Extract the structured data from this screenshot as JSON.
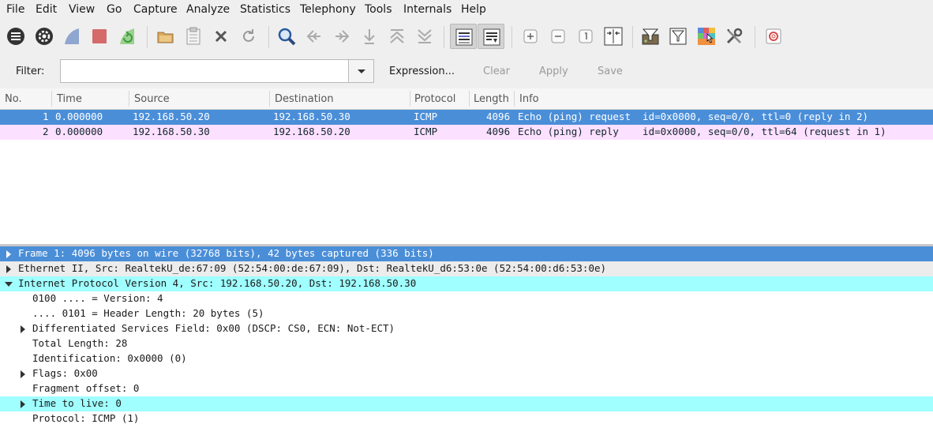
{
  "menubar": {
    "items": [
      "File",
      "Edit",
      "View",
      "Go",
      "Capture",
      "Analyze",
      "Statistics",
      "Telephony",
      "Tools",
      "Internals",
      "Help"
    ]
  },
  "toolbar": {
    "buttons": [
      "interface-list",
      "capture-options",
      "start-capture",
      "stop-capture",
      "restart-capture",
      "open-file",
      "save-file",
      "close-file",
      "reload-file",
      "find-packet",
      "go-back",
      "go-forward",
      "go-to-packet",
      "go-first",
      "go-last",
      "colorize",
      "auto-scroll",
      "zoom-in",
      "zoom-out",
      "normal-size",
      "resize-columns",
      "capture-filters",
      "display-filters",
      "coloring-rules",
      "preferences",
      "help"
    ]
  },
  "filter": {
    "label": "Filter:",
    "value": "",
    "placeholder": "",
    "expression_label": "Expression...",
    "clear_label": "Clear",
    "apply_label": "Apply",
    "save_label": "Save"
  },
  "packet_list": {
    "columns": [
      "No.",
      "Time",
      "Source",
      "Destination",
      "Protocol",
      "Length",
      "Info"
    ],
    "rows": [
      {
        "no": "1",
        "time": "0.000000",
        "source": "192.168.50.20",
        "destination": "192.168.50.30",
        "protocol": "ICMP",
        "length": "4096",
        "info": "Echo (ping) request  id=0x0000, seq=0/0, ttl=0 (reply in 2)"
      },
      {
        "no": "2",
        "time": "0.000000",
        "source": "192.168.50.30",
        "destination": "192.168.50.20",
        "protocol": "ICMP",
        "length": "4096",
        "info": "Echo (ping) reply    id=0x0000, seq=0/0, ttl=64 (request in 1)"
      }
    ]
  },
  "details": {
    "rows": [
      {
        "text": "Frame 1: 4096 bytes on wire (32768 bits), 42 bytes captured (336 bits)"
      },
      {
        "text": "Ethernet II, Src: RealtekU_de:67:09 (52:54:00:de:67:09), Dst: RealtekU_d6:53:0e (52:54:00:d6:53:0e)"
      },
      {
        "text": "Internet Protocol Version 4, Src: 192.168.50.20, Dst: 192.168.50.30"
      },
      {
        "text": "0100 .... = Version: 4"
      },
      {
        "text": ".... 0101 = Header Length: 20 bytes (5)"
      },
      {
        "text": "Differentiated Services Field: 0x00 (DSCP: CS0, ECN: Not-ECT)"
      },
      {
        "text": "Total Length: 28"
      },
      {
        "text": "Identification: 0x0000 (0)"
      },
      {
        "text": "Flags: 0x00"
      },
      {
        "text": "Fragment offset: 0"
      },
      {
        "text": "Time to live: 0"
      },
      {
        "text": "Protocol: ICMP (1)"
      }
    ]
  },
  "colors": {
    "selected": "#4a8ed8",
    "icmp_row": "#fce0ff",
    "expert_highlight": "#a0ffff"
  }
}
